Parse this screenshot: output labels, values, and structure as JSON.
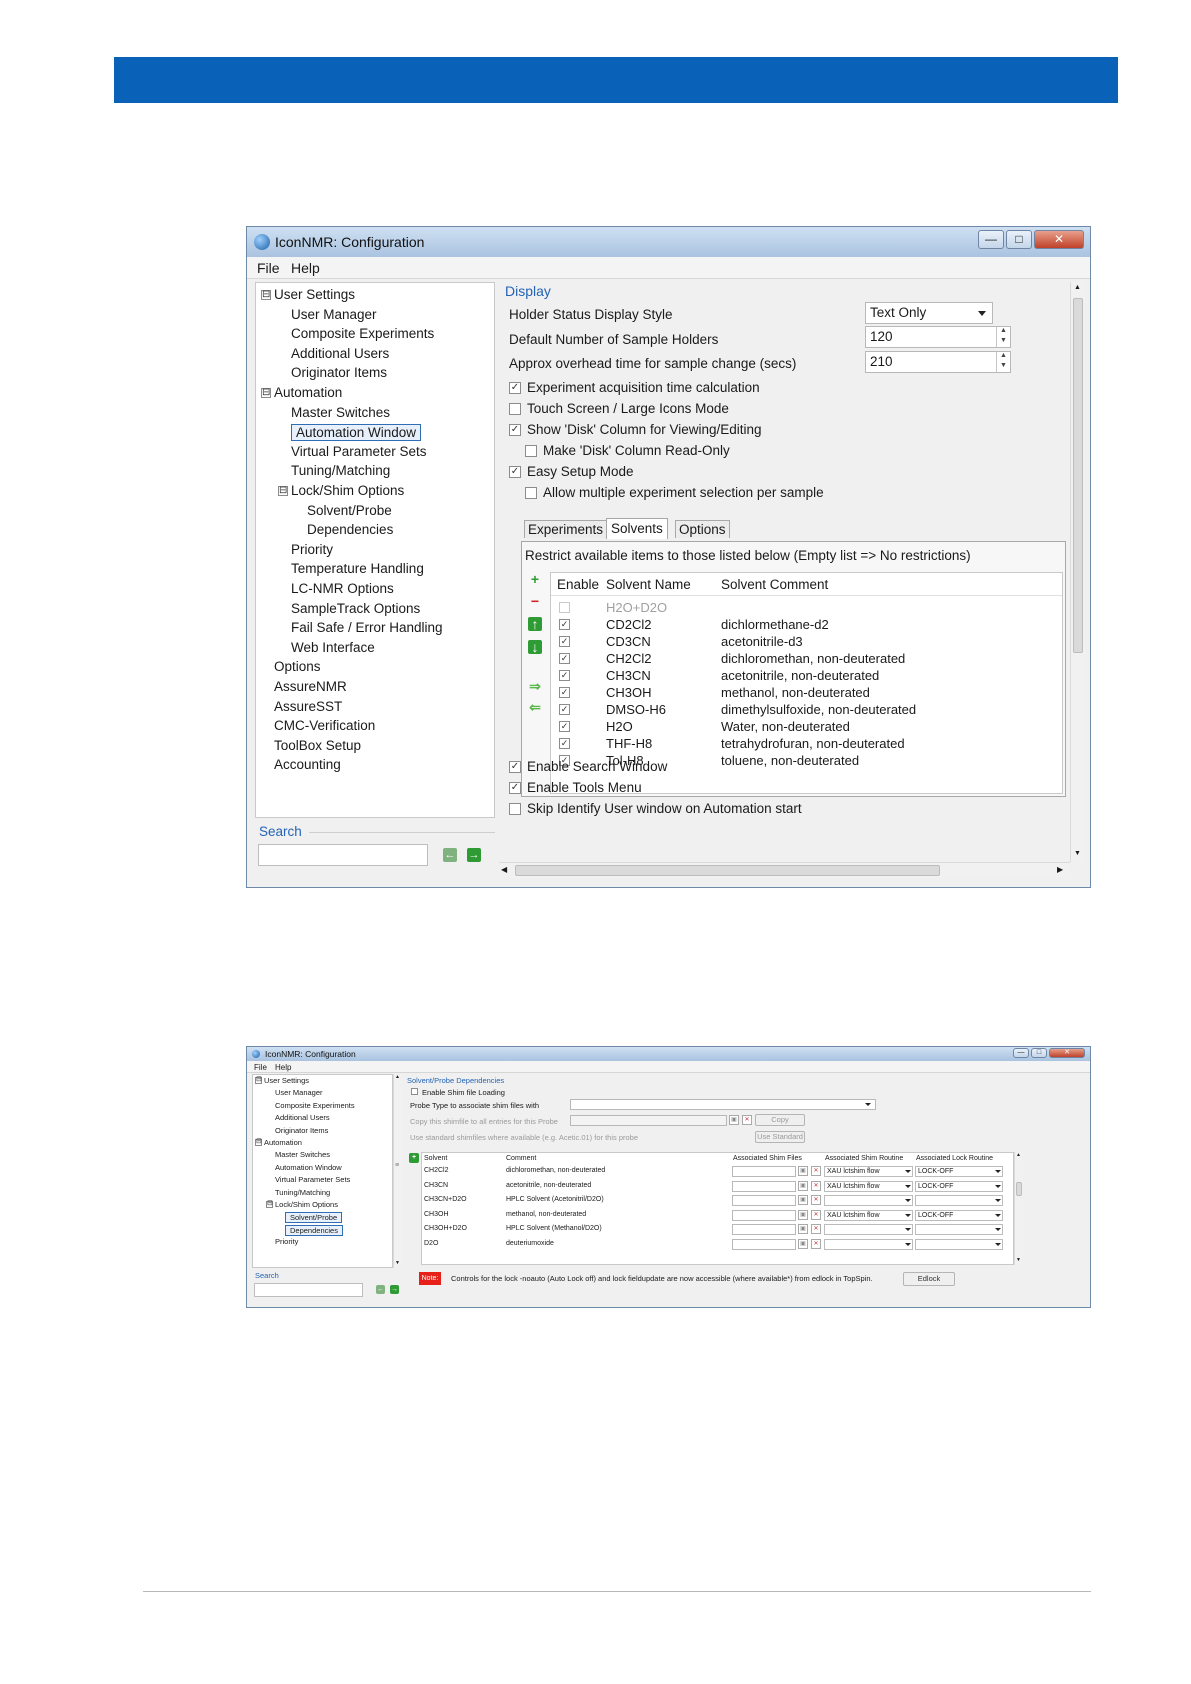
{
  "window1": {
    "title": "IconNMR: Configuration",
    "menu": [
      "File",
      "Help"
    ],
    "tree": [
      {
        "label": "User Settings",
        "level": 0,
        "expander": "⊟"
      },
      {
        "label": "User Manager",
        "level": 1
      },
      {
        "label": "Composite Experiments",
        "level": 1
      },
      {
        "label": "Additional Users",
        "level": 1
      },
      {
        "label": "Originator Items",
        "level": 1
      },
      {
        "label": "Automation",
        "level": 0,
        "expander": "⊟"
      },
      {
        "label": "Master Switches",
        "level": 1
      },
      {
        "label": "Automation Window",
        "level": 1,
        "selected": true
      },
      {
        "label": "Virtual Parameter Sets",
        "level": 1
      },
      {
        "label": "Tuning/Matching",
        "level": 1
      },
      {
        "label": "Lock/Shim Options",
        "level": 1,
        "expander": "⊟"
      },
      {
        "label": "Solvent/Probe",
        "level": 2
      },
      {
        "label": "Dependencies",
        "level": 2
      },
      {
        "label": "Priority",
        "level": 1
      },
      {
        "label": "Temperature Handling",
        "level": 1
      },
      {
        "label": "LC-NMR Options",
        "level": 1
      },
      {
        "label": "SampleTrack Options",
        "level": 1
      },
      {
        "label": "Fail Safe / Error Handling",
        "level": 1
      },
      {
        "label": "Web Interface",
        "level": 1
      },
      {
        "label": "Options",
        "level": 0
      },
      {
        "label": "AssureNMR",
        "level": 0
      },
      {
        "label": "AssureSST",
        "level": 0
      },
      {
        "label": "CMC-Verification",
        "level": 0
      },
      {
        "label": "ToolBox Setup",
        "level": 0
      },
      {
        "label": "Accounting",
        "level": 0
      }
    ],
    "search_label": "Search",
    "section_title": "Display",
    "holder_status_label": "Holder Status Display Style",
    "holder_status_value": "Text Only",
    "default_holders_label": "Default Number of Sample Holders",
    "default_holders_value": "120",
    "overhead_label": "Approx overhead time for sample change (secs)",
    "overhead_value": "210",
    "checkboxes": [
      {
        "label": "Experiment acquisition time calculation",
        "checked": true,
        "indent": false
      },
      {
        "label": "Touch Screen / Large Icons Mode",
        "checked": false,
        "indent": false
      },
      {
        "label": "Show 'Disk' Column for Viewing/Editing",
        "checked": true,
        "indent": false
      },
      {
        "label": "Make 'Disk' Column Read-Only",
        "checked": false,
        "indent": true
      },
      {
        "label": "Easy Setup Mode",
        "checked": true,
        "indent": false
      },
      {
        "label": "Allow multiple experiment selection per sample",
        "checked": false,
        "indent": true
      }
    ],
    "tabs": [
      "Experiments",
      "Solvents",
      "Options"
    ],
    "active_tab": "Solvents",
    "restrict_text": "Restrict available items to those listed below (Empty list => No restrictions)",
    "grid_headers": [
      "Enable",
      "Solvent Name",
      "Solvent Comment"
    ],
    "solvents": [
      {
        "enabled": false,
        "name": "H2O+D2O",
        "comment": "",
        "disabled": true
      },
      {
        "enabled": true,
        "name": "CD2Cl2",
        "comment": "dichlormethane-d2"
      },
      {
        "enabled": true,
        "name": "CD3CN",
        "comment": "acetonitrile-d3"
      },
      {
        "enabled": true,
        "name": "CH2Cl2",
        "comment": "dichloromethan, non-deuterated"
      },
      {
        "enabled": true,
        "name": "CH3CN",
        "comment": "acetonitrile, non-deuterated"
      },
      {
        "enabled": true,
        "name": "CH3OH",
        "comment": "methanol, non-deuterated"
      },
      {
        "enabled": true,
        "name": "DMSO-H6",
        "comment": "dimethylsulfoxide, non-deuterated"
      },
      {
        "enabled": true,
        "name": "H2O",
        "comment": "Water, non-deuterated"
      },
      {
        "enabled": true,
        "name": "THF-H8",
        "comment": "tetrahydrofuran, non-deuterated"
      },
      {
        "enabled": true,
        "name": "Tol-H8",
        "comment": "toluene, non-deuterated"
      }
    ],
    "side_icons": [
      "add-icon",
      "remove-icon",
      "move-up-icon",
      "move-down-icon",
      "import-icon",
      "export-icon"
    ],
    "bottom_checkboxes": [
      {
        "label": "Enable Search Window",
        "checked": true
      },
      {
        "label": "Enable Tools Menu",
        "checked": true
      },
      {
        "label": "Skip Identify User window on Automation start",
        "checked": false
      }
    ]
  },
  "window2": {
    "title": "IconNMR: Configuration",
    "menu": [
      "File",
      "Help"
    ],
    "tree": [
      {
        "label": "User Settings",
        "level": 0,
        "expander": "⊟"
      },
      {
        "label": "User Manager",
        "level": 1
      },
      {
        "label": "Composite Experiments",
        "level": 1
      },
      {
        "label": "Additional Users",
        "level": 1
      },
      {
        "label": "Originator Items",
        "level": 1
      },
      {
        "label": "Automation",
        "level": 0,
        "expander": "⊟"
      },
      {
        "label": "Master Switches",
        "level": 1
      },
      {
        "label": "Automation Window",
        "level": 1
      },
      {
        "label": "Virtual Parameter Sets",
        "level": 1
      },
      {
        "label": "Tuning/Matching",
        "level": 1
      },
      {
        "label": "Lock/Shim Options",
        "level": 1,
        "expander": "⊟"
      },
      {
        "label": "Solvent/Probe",
        "level": 2,
        "selected": true
      },
      {
        "label": "Dependencies",
        "level": 2,
        "selected": true
      },
      {
        "label": "Priority",
        "level": 1
      }
    ],
    "search_label": "Search",
    "section_title": "Solvent/Probe Dependencies",
    "enable_shim_label": "Enable Shim file Loading",
    "probe_type_label": "Probe Type to associate shim files with",
    "copy_label": "Copy this shimfile to all entries for this Probe",
    "copy_button": "Copy",
    "use_standard_label": "Use standard shimfiles where available (e.g. Acetic.01) for this probe",
    "use_standard_button": "Use Standard",
    "grid_headers": [
      "Solvent",
      "Comment",
      "Associated Shim Files",
      "Associated Shim Routine",
      "Associated Lock Routine"
    ],
    "rows": [
      {
        "solvent": "CH2Cl2",
        "comment": "dichloromethan, non-deuterated",
        "shim": "XAU lctshim flow",
        "lock": "LOCK-OFF"
      },
      {
        "solvent": "CH3CN",
        "comment": "acetonitrile, non-deuterated",
        "shim": "XAU lctshim flow",
        "lock": "LOCK-OFF"
      },
      {
        "solvent": "CH3CN+D2O",
        "comment": "HPLC Solvent (Acetonitril/D2O)",
        "shim": "",
        "lock": ""
      },
      {
        "solvent": "CH3OH",
        "comment": "methanol, non-deuterated",
        "shim": "XAU lctshim flow",
        "lock": "LOCK-OFF"
      },
      {
        "solvent": "CH3OH+D2O",
        "comment": "HPLC Solvent (Methanol/D2O)",
        "shim": "",
        "lock": ""
      },
      {
        "solvent": "D2O",
        "comment": "deuteriumoxide",
        "shim": "",
        "lock": ""
      }
    ],
    "note_flag": "Note:",
    "note_text": "Controls for the lock -noauto (Auto Lock off) and lock fieldupdate are now accessible (where available*) from edlock in TopSpin.",
    "edlock_button": "Edlock"
  }
}
